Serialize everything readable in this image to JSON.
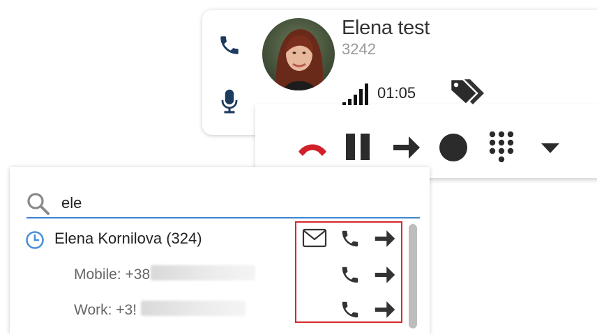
{
  "call": {
    "caller_name": "Elena test",
    "caller_number": "3242",
    "timer": "01:05",
    "signal_bars": 5
  },
  "search": {
    "query": "ele"
  },
  "results": {
    "contact_name": "Elena Kornilova (324)",
    "mobile_label": "Mobile: +38",
    "work_label": "Work: +3!"
  },
  "colors": {
    "hangup": "#d0202a",
    "accent": "#3a86d0",
    "highlight_border": "#d6282c",
    "icon_dark": "#2b2b2b",
    "clock": "#4a90d9"
  },
  "icons": {
    "phone": "phone-icon",
    "microphone": "microphone-icon",
    "tag": "tag-icon",
    "hangup": "hangup-icon",
    "pause": "pause-icon",
    "transfer": "arrow-right-icon",
    "record": "record-icon",
    "dialpad": "dialpad-icon",
    "menu": "caret-down-icon",
    "search": "search-icon",
    "history": "clock-icon",
    "email": "envelope-icon"
  }
}
